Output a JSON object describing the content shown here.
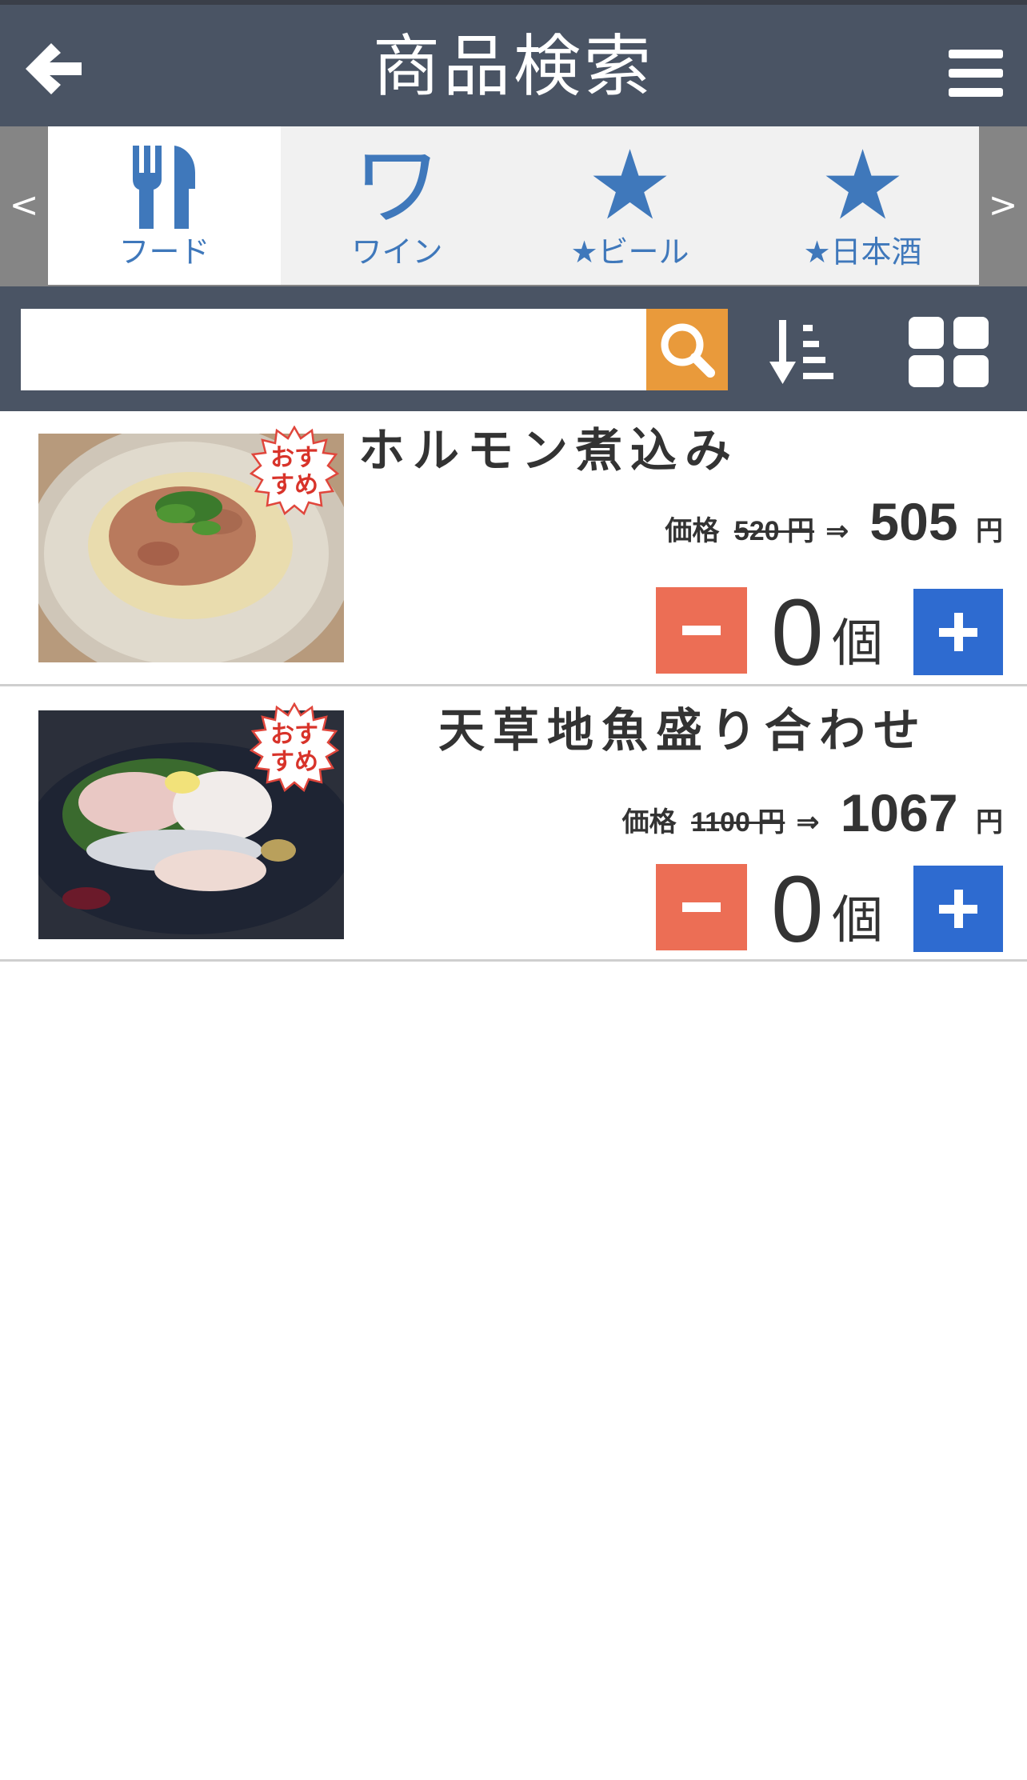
{
  "header": {
    "title": "商品検索",
    "back_icon": "back-arrow-icon",
    "menu_icon": "hamburger-menu-icon"
  },
  "categories": {
    "prev_label": "<",
    "next_label": ">",
    "tabs": [
      {
        "label": "フード",
        "icon": "fork-knife-icon",
        "active": true
      },
      {
        "label": "ワイン",
        "icon_text": "ワ",
        "active": false
      },
      {
        "label": "★ビール",
        "icon": "star-icon",
        "icon_text": "★",
        "active": false
      },
      {
        "label": "★日本酒",
        "icon": "star-icon",
        "icon_text": "★",
        "active": false
      }
    ],
    "accent_color": "#3f78bb"
  },
  "search": {
    "value": "",
    "placeholder": "",
    "search_icon": "search-icon",
    "sort_icon": "sort-icon",
    "view_icon": "grid-view-icon"
  },
  "products": [
    {
      "name": "ホルモン煮込み",
      "badge": "おすすめ",
      "price_label": "価格",
      "old_price": "520 円",
      "arrow": "⇒",
      "new_price": "505",
      "currency": "円",
      "quantity": "0",
      "unit": "個"
    },
    {
      "name": "天草地魚盛り合わせ",
      "badge": "おすすめ",
      "price_label": "価格",
      "old_price": "1100 円",
      "arrow": "⇒",
      "new_price": "1067",
      "currency": "円",
      "quantity": "0",
      "unit": "個"
    }
  ],
  "colors": {
    "header_bg": "#4a5464",
    "search_button": "#e99a3b",
    "minus_button": "#ec6e55",
    "plus_button": "#2e6bd0"
  }
}
